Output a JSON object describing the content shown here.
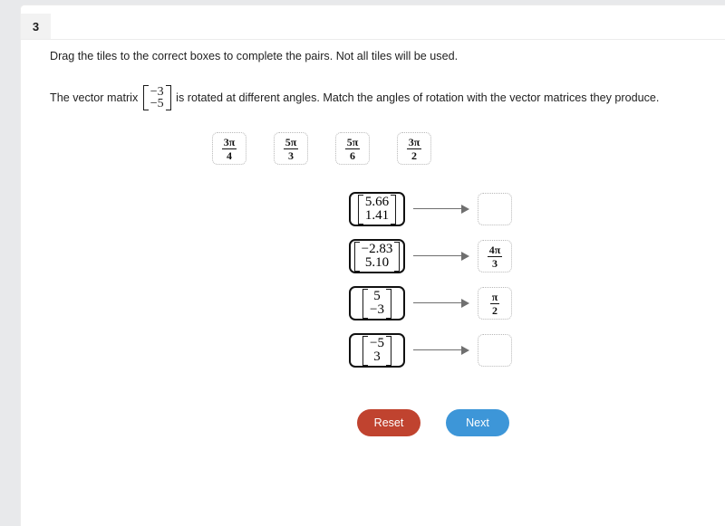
{
  "question": {
    "number": "3",
    "instruction": "Drag the tiles to the correct boxes to complete the pairs. Not all tiles will be used.",
    "prompt_before": "The vector matrix ",
    "prompt_after": " is rotated at different angles. Match the angles of rotation with the vector matrices they produce.",
    "vector": {
      "top": "−3",
      "bottom": "−5"
    }
  },
  "tiles": [
    {
      "numerator": "3π",
      "denominator": "4",
      "label": "3π/4"
    },
    {
      "numerator": "5π",
      "denominator": "3",
      "label": "5π/3"
    },
    {
      "numerator": "5π",
      "denominator": "6",
      "label": "5π/6"
    },
    {
      "numerator": "3π",
      "denominator": "2",
      "label": "3π/2"
    }
  ],
  "rows": [
    {
      "matrix": {
        "top": "5.66",
        "bottom": "1.41"
      },
      "answer": {
        "filled": false,
        "numerator": "",
        "denominator": "",
        "label": ""
      }
    },
    {
      "matrix": {
        "top": "−2.83",
        "bottom": "5.10"
      },
      "answer": {
        "filled": true,
        "numerator": "4π",
        "denominator": "3",
        "label": "4π/3"
      }
    },
    {
      "matrix": {
        "top": "5",
        "bottom": "−3"
      },
      "answer": {
        "filled": true,
        "numerator": "π",
        "denominator": "2",
        "label": "π/2"
      }
    },
    {
      "matrix": {
        "top": "−5",
        "bottom": "3"
      },
      "answer": {
        "filled": false,
        "numerator": "",
        "denominator": "",
        "label": ""
      }
    }
  ],
  "buttons": {
    "reset_label": "Reset",
    "next_label": "Next"
  },
  "colors": {
    "reset": "#c0432f",
    "next": "#3d96d8",
    "page_background": "#e8e9eb",
    "card_background": "#ffffff",
    "tab_background": "#f2f2f2"
  }
}
